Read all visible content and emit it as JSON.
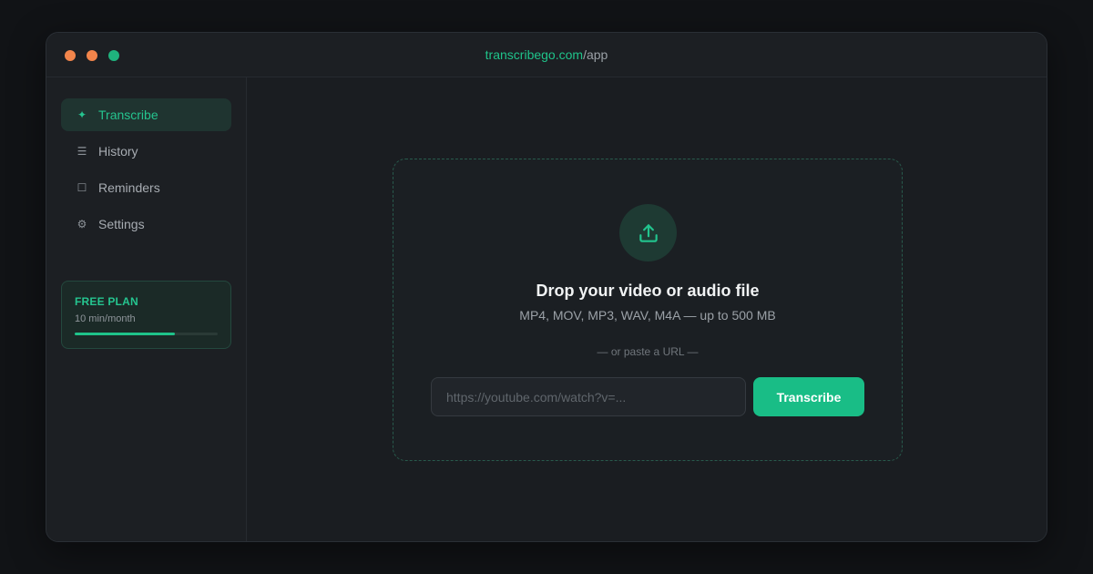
{
  "window": {
    "controls": [
      {
        "name": "close",
        "color": "#f2854b"
      },
      {
        "name": "minimize",
        "color": "#f2854b"
      },
      {
        "name": "maximize",
        "color": "#1fb37d"
      }
    ],
    "url_host": "transcribego.com",
    "url_path": "/app"
  },
  "sidebar": {
    "items": [
      {
        "label": "Transcribe",
        "icon": "sparkle-icon",
        "glyph": "✦",
        "active": true
      },
      {
        "label": "History",
        "icon": "list-icon",
        "glyph": "☰",
        "active": false
      },
      {
        "label": "Reminders",
        "icon": "square-icon",
        "glyph": "☐",
        "active": false
      },
      {
        "label": "Settings",
        "icon": "gear-icon",
        "glyph": "⚙",
        "active": false
      }
    ],
    "plan": {
      "title": "FREE PLAN",
      "subtitle": "10 min/month",
      "usage_fraction": 0.7
    }
  },
  "main": {
    "dropzone": {
      "icon": "upload-icon",
      "title": "Drop your video or audio file",
      "subtitle": "MP4, MOV, MP3, WAV, M4A — up to 500 MB",
      "divider": "— or paste a URL —"
    },
    "url_input": {
      "value": "",
      "placeholder": "https://youtube.com/watch?v=..."
    },
    "submit_label": "Transcribe"
  },
  "colors": {
    "accent": "#1fc38a",
    "background": "#1a1d21"
  }
}
